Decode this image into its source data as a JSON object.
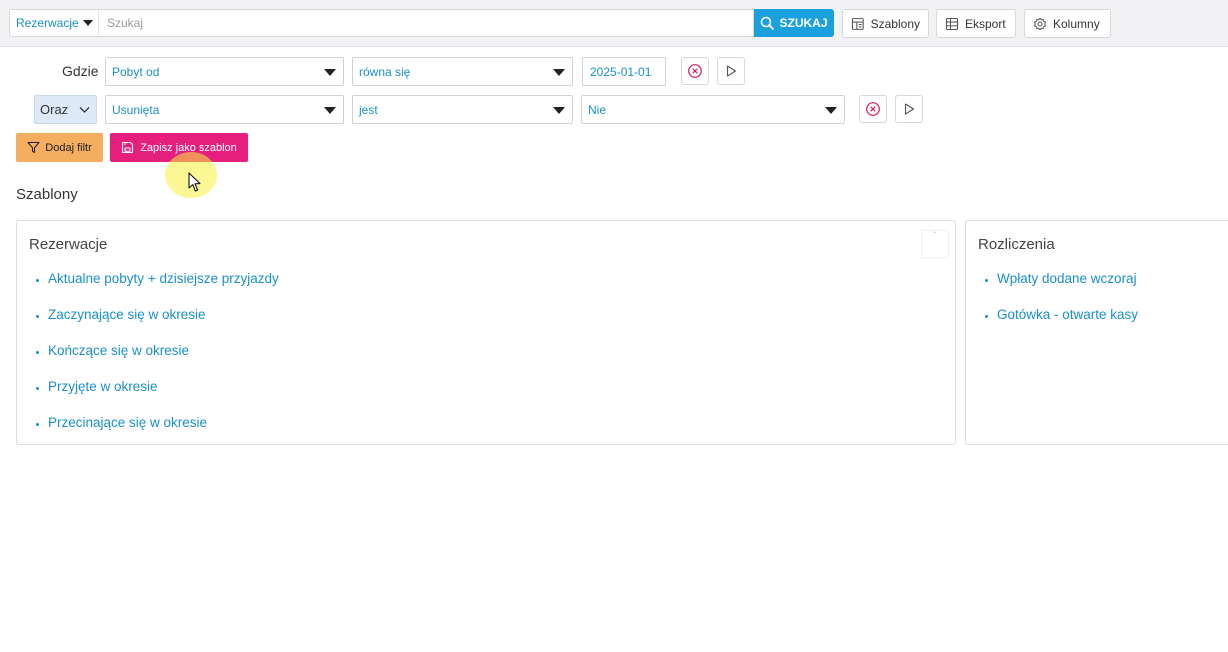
{
  "topbar": {
    "scope_label": "Rezerwacje",
    "search_placeholder": "Szukaj",
    "search_button": "SZUKAJ",
    "templates_button": "Szablony",
    "export_button": "Eksport",
    "columns_button": "Kolumny"
  },
  "filters": {
    "row1": {
      "label": "Gdzie",
      "field": "Pobyt od",
      "operator": "równa się",
      "value": "2025-01-01"
    },
    "row2": {
      "connector": "Oraz",
      "field": "Usunięta",
      "operator": "jest",
      "value": "Nie"
    }
  },
  "actions": {
    "add_filter": "Dodaj filtr",
    "save_template": "Zapisz jako szablon"
  },
  "templates": {
    "title": "Szablony",
    "groups": [
      {
        "title": "Rezerwacje",
        "items": [
          "Aktualne pobyty + dzisiejsze przyjazdy",
          "Zaczynające się w okresie",
          "Kończące się w okresie",
          "Przyjęte w okresie",
          "Przecinające się w okresie"
        ]
      },
      {
        "title": "Rozliczenia",
        "items": [
          "Wpłaty dodane wczoraj",
          "Gotówka - otwarte kasy"
        ]
      }
    ]
  },
  "colors": {
    "accent": "#1aa0dd",
    "save": "#e61e7e",
    "add": "#f5ad5f",
    "link": "#1a8fc9",
    "remove": "#d81b60"
  }
}
